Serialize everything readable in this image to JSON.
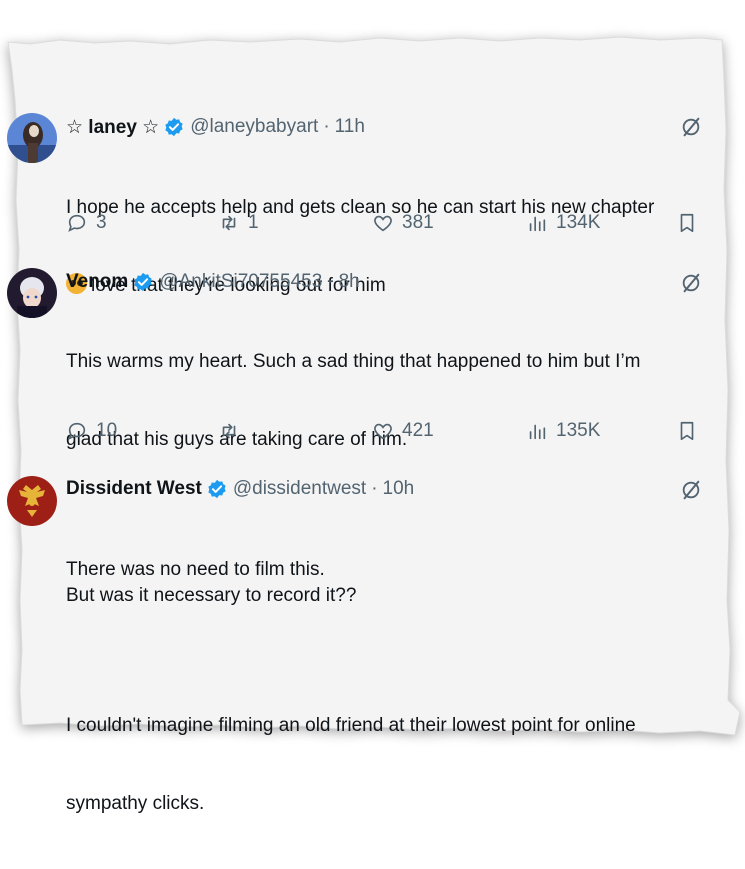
{
  "colors": {
    "verified": "#1d9bf0",
    "text": "#0f1419",
    "muted": "#536471",
    "paper": "#f4f4f4"
  },
  "tweets": [
    {
      "name": "☆ laney ☆",
      "handle": "@laneybabyart",
      "separator": "·",
      "time": "11h",
      "avatar_icon": "avatar-anime-character-blue",
      "text_lines": [
        "I hope he accepts help and gets clean so he can start his new chapter",
        "love that they’re looking out for him"
      ],
      "emoji_icon": "pleading-face-emoji",
      "replies": "3",
      "reposts": "1",
      "likes": "381",
      "views": "134K"
    },
    {
      "name": "Venom",
      "handle": "@AnkitSi70755453",
      "separator": "·",
      "time": "8h",
      "avatar_icon": "avatar-anime-character-dark",
      "text_lines": [
        "This warms my heart. Such a sad thing that happened to him but I’m",
        "glad that his guys are taking care of him.",
        "",
        "But was it necessary to record it??"
      ],
      "replies": "10",
      "reposts": "",
      "likes": "421",
      "views": "135K"
    },
    {
      "name": "Dissident West",
      "handle": "@dissidentwest",
      "separator": "·",
      "time": "10h",
      "avatar_icon": "avatar-double-headed-eagle-red",
      "text_lines": [
        "There was no need to film this.",
        "",
        "I couldn't imagine filming an old friend at their lowest point for online",
        "sympathy clicks."
      ]
    }
  ]
}
